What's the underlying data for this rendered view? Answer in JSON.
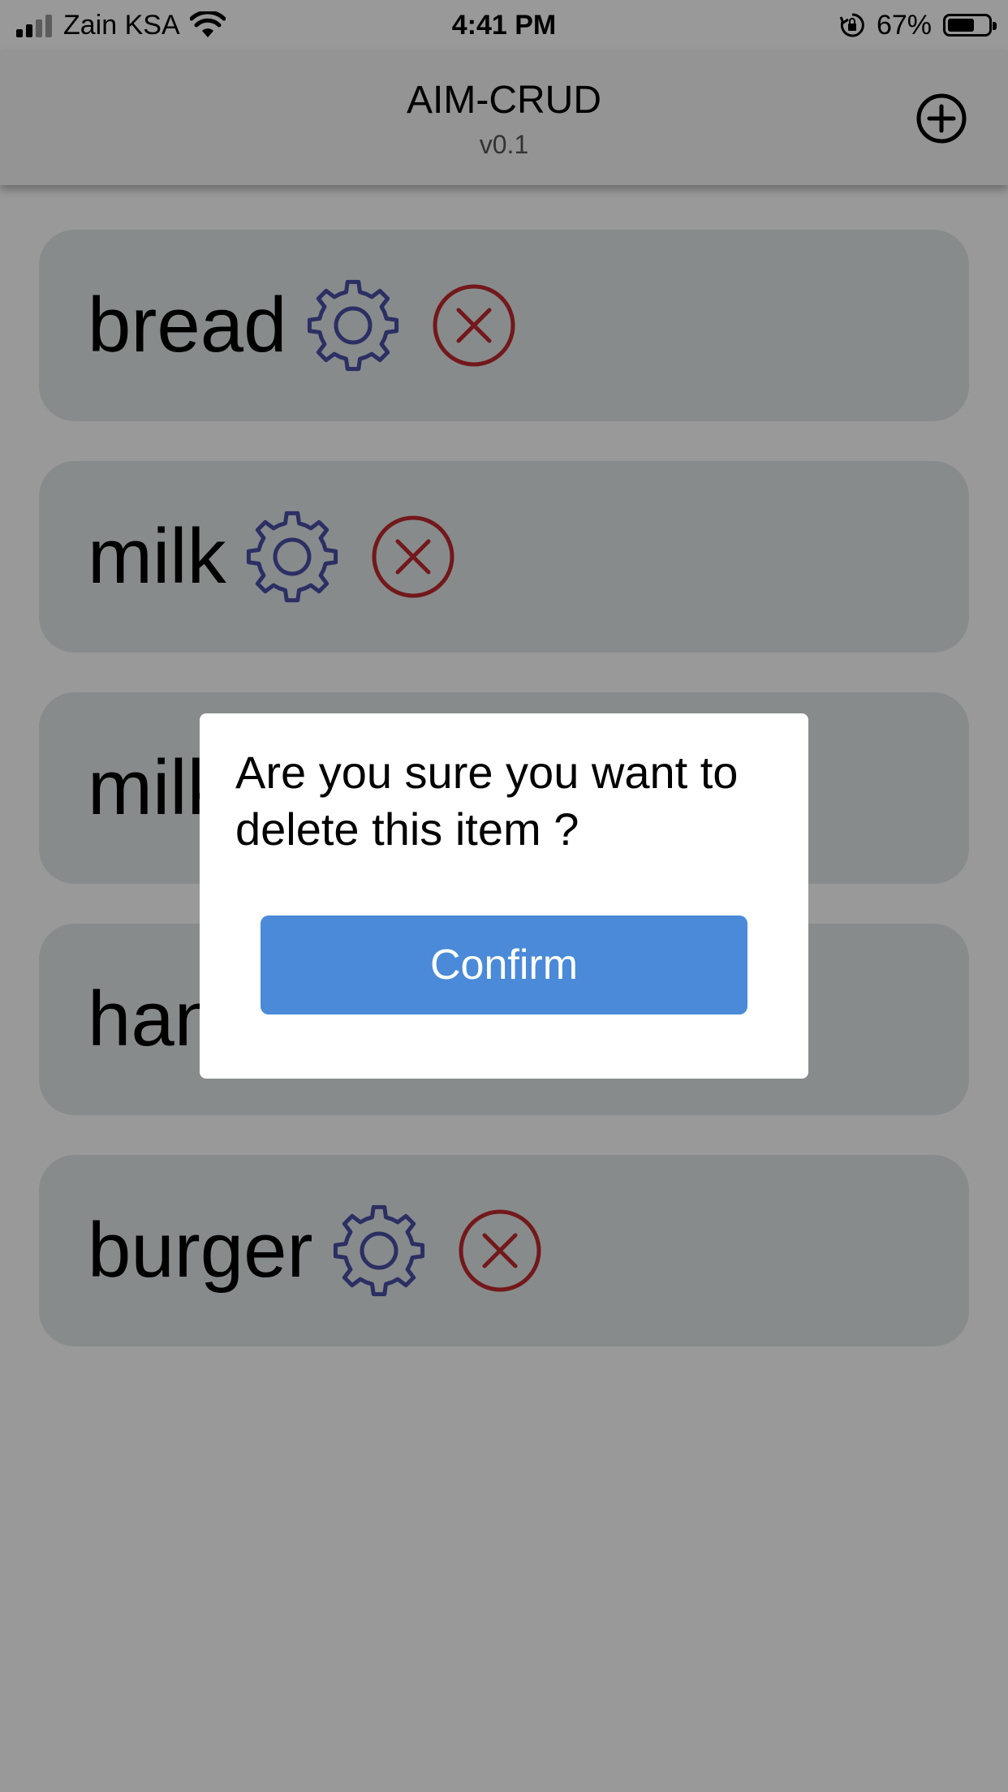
{
  "status_bar": {
    "carrier": "Zain KSA",
    "time": "4:41 PM",
    "battery_percent": "67%",
    "battery_level": 0.67,
    "icons": [
      "signal-icon",
      "wifi-icon",
      "orientation-lock-icon",
      "battery-icon"
    ]
  },
  "header": {
    "title": "AIM-CRUD",
    "subtitle": "v0.1",
    "add_icon": "plus-circle-icon"
  },
  "items": [
    {
      "name": "bread"
    },
    {
      "name": "milk"
    },
    {
      "name": "milk"
    },
    {
      "name": "han"
    },
    {
      "name": "burger"
    }
  ],
  "dialog": {
    "message": "Are you sure you want to delete this item ?",
    "confirm_label": "Confirm"
  },
  "colors": {
    "card_background": "#e1e8e8",
    "gear_icon": "#4a4fa6",
    "delete_icon": "#c0282d",
    "confirm_button": "#4a8ad8",
    "overlay": "rgba(0,0,0,0.4)"
  }
}
